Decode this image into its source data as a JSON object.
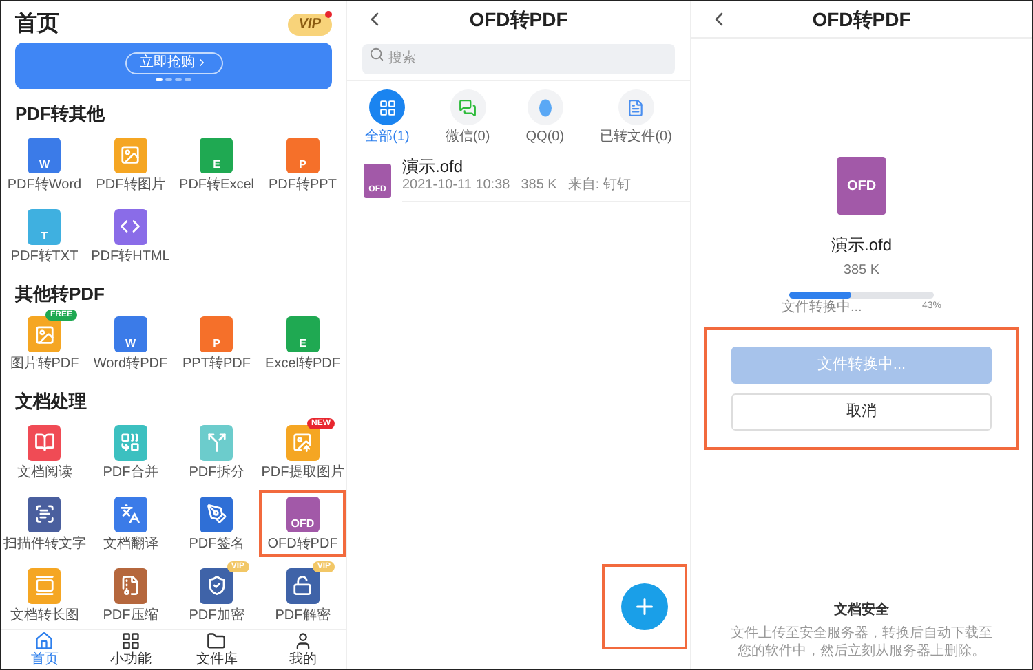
{
  "home": {
    "title": "首页",
    "vip_badge": "VIP",
    "banner": {
      "button": "立即抢购",
      "dots": [
        {
          "selected": true
        },
        {
          "selected": false
        },
        {
          "selected": false
        },
        {
          "selected": false
        }
      ]
    },
    "sections": [
      {
        "title": "PDF转其他",
        "tools": [
          {
            "label": "PDF转Word",
            "kind": "doc",
            "icon_text": "W",
            "color": "#3b7be8",
            "highlighted": false
          },
          {
            "label": "PDF转图片",
            "kind": "image",
            "color": "#f5a623",
            "highlighted": false
          },
          {
            "label": "PDF转Excel",
            "kind": "doc",
            "icon_text": "E",
            "color": "#1fa952",
            "highlighted": false
          },
          {
            "label": "PDF转PPT",
            "kind": "doc",
            "icon_text": "P",
            "color": "#f5702a",
            "highlighted": false
          },
          {
            "label": "PDF转TXT",
            "kind": "doc",
            "icon_text": "T",
            "color": "#3fb0e0",
            "highlighted": false
          },
          {
            "label": "PDF转HTML",
            "kind": "code",
            "color": "#8a6ce8",
            "highlighted": false
          }
        ]
      },
      {
        "title": "其他转PDF",
        "tools": [
          {
            "label": "图片转PDF",
            "kind": "image",
            "color": "#f5a623",
            "badge": {
              "text": "FREE",
              "color": "#1fa952"
            },
            "highlighted": false
          },
          {
            "label": "Word转PDF",
            "kind": "doc",
            "icon_text": "W",
            "color": "#3b7be8",
            "highlighted": false
          },
          {
            "label": "PPT转PDF",
            "kind": "doc",
            "icon_text": "P",
            "color": "#f5702a",
            "highlighted": false
          },
          {
            "label": "Excel转PDF",
            "kind": "doc",
            "icon_text": "E",
            "color": "#1fa952",
            "highlighted": false
          }
        ]
      },
      {
        "title": "文档处理",
        "tools": [
          {
            "label": "文档阅读",
            "kind": "read",
            "color": "#f04b55",
            "highlighted": false
          },
          {
            "label": "PDF合并",
            "kind": "merge",
            "color": "#3cc0c0",
            "highlighted": false
          },
          {
            "label": "PDF拆分",
            "kind": "split",
            "color": "#6ccccc",
            "highlighted": false
          },
          {
            "label": "PDF提取图片",
            "kind": "extract",
            "color": "#f5a623",
            "badge": {
              "text": "NEW",
              "color": "#e8262e"
            },
            "highlighted": false
          },
          {
            "label": "扫描件转文字",
            "kind": "scan",
            "color": "#4a5f9e",
            "highlighted": false
          },
          {
            "label": "文档翻译",
            "kind": "translate",
            "color": "#3b7be8",
            "highlighted": false
          },
          {
            "label": "PDF签名",
            "kind": "pen",
            "color": "#2f6fd6",
            "highlighted": false
          },
          {
            "label": "OFD转PDF",
            "kind": "doc",
            "icon_text": "OFD",
            "color": "#a259a8",
            "highlighted": true
          },
          {
            "label": "文档转长图",
            "kind": "long",
            "color": "#f5a623",
            "highlighted": false
          },
          {
            "label": "PDF压缩",
            "kind": "zip",
            "color": "#b5673d",
            "highlighted": false
          },
          {
            "label": "PDF加密",
            "kind": "lock",
            "color": "#3f63a8",
            "badge": {
              "text": "VIP",
              "color": "#f2c766"
            },
            "highlighted": false
          },
          {
            "label": "PDF解密",
            "kind": "unlock",
            "color": "#3f63a8",
            "badge": {
              "text": "VIP",
              "color": "#f2c766"
            },
            "highlighted": false
          }
        ]
      }
    ],
    "bottom_nav": [
      {
        "label": "首页",
        "kind": "home",
        "selected": true
      },
      {
        "label": "小功能",
        "kind": "grid",
        "selected": false
      },
      {
        "label": "文件库",
        "kind": "folder",
        "selected": false
      },
      {
        "label": "我的",
        "kind": "user",
        "selected": false
      }
    ]
  },
  "file_list": {
    "title": "OFD转PDF",
    "search": {
      "placeholder": "搜索"
    },
    "sources": [
      {
        "label": "全部(1)",
        "kind": "all",
        "selected": true
      },
      {
        "label": "微信(0)",
        "kind": "wechat",
        "selected": false
      },
      {
        "label": "QQ(0)",
        "kind": "qq",
        "selected": false
      },
      {
        "label": "已转文件(0)",
        "kind": "converted",
        "selected": false
      }
    ],
    "files": [
      {
        "name": "演示.ofd",
        "icon_text": "OFD",
        "date": "2021-10-11 10:38",
        "size": "385 K",
        "source": "来自: 钉钉"
      }
    ],
    "fab": {
      "highlighted": true
    }
  },
  "converting": {
    "title": "OFD转PDF",
    "file": {
      "icon_text": "OFD",
      "name": "演示.ofd",
      "size": "385 K"
    },
    "progress": {
      "level": 0.43,
      "status": "文件转换中...",
      "percent": "43%"
    },
    "actions": {
      "highlighted": true,
      "primary": {
        "label": "文件转换中...",
        "disabled": true
      },
      "cancel": "取消"
    },
    "security": {
      "title": "文档安全",
      "text": "文件上传至安全服务器，转换后自动下载至您的软件中，然后立刻从服务器上删除。"
    }
  }
}
